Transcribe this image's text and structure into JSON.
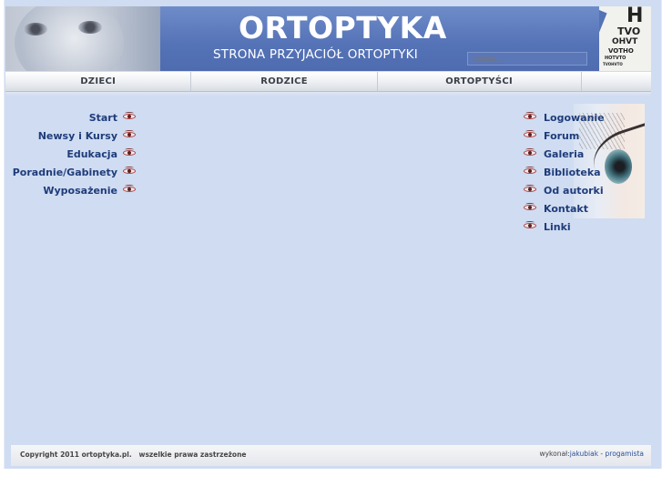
{
  "header": {
    "title": "ORTOPTYKA",
    "subtitle": "STRONA PRZYJACIÓŁ ORTOPTYKI",
    "search_placeholder": "szukaj...",
    "eye_chart_letters": [
      "H",
      "TVO",
      "OHVT",
      "VOTHO",
      "HOTVTO",
      "TVOHVTO"
    ]
  },
  "nav": {
    "tabs": [
      "DZIECI",
      "RODZICE",
      "ORTOPTYŚCI"
    ]
  },
  "left_menu": [
    "Start",
    "Newsy i Kursy",
    "Edukacja",
    "Poradnie/Gabinety",
    "Wyposażenie"
  ],
  "right_menu": [
    "Logowanie",
    "Forum",
    "Galeria",
    "Biblioteka",
    "Od autorki",
    "Kontakt",
    "Linki"
  ],
  "footer": {
    "copyright": "Copyright 2011 ortoptyka.pl.   wszelkie prawa zastrzeżone",
    "made_by_label": "wykonał:",
    "author": "jakubiak",
    "separator": " - ",
    "author_role": "progamista"
  },
  "icons": {
    "menu_bullet": "eye-icon"
  }
}
